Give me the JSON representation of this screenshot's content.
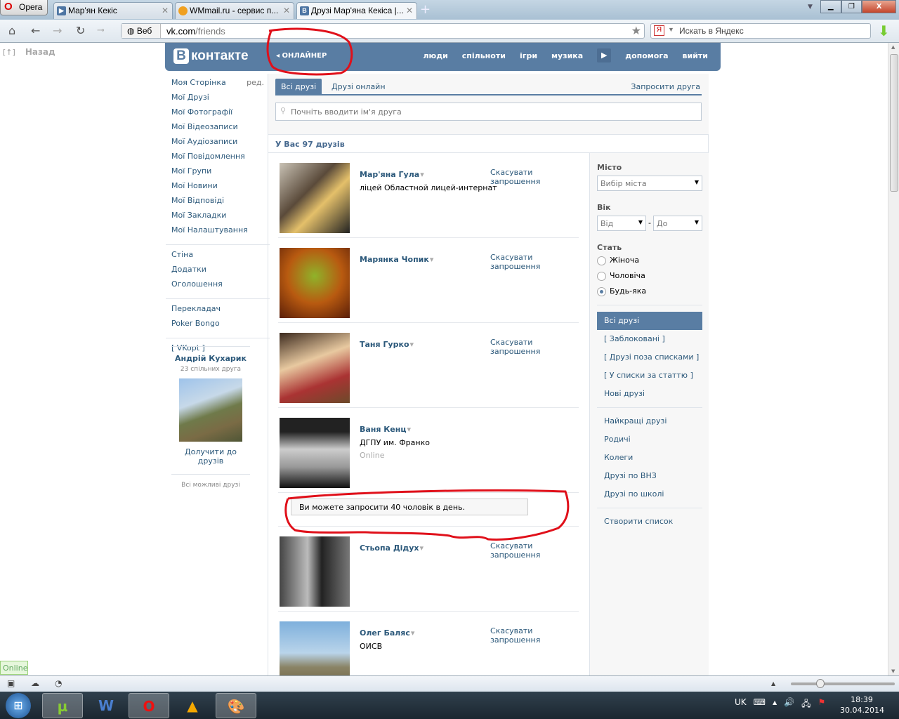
{
  "browser": {
    "menu_label": "Opera",
    "tabs": [
      {
        "title": "Мар'ян Кекіс",
        "icon": "vk-icon"
      },
      {
        "title": "WMmail.ru - сервис п...",
        "icon": "wmmail-icon"
      },
      {
        "title": "Друзі Мар'яна Кекіса |...",
        "icon": "vk-icon",
        "active": true
      }
    ],
    "address_prefix": "Веб",
    "url_host": "vk.com",
    "url_path": "/friends",
    "search_placeholder": "Искать в Яндекс"
  },
  "page": {
    "back_label": "Назад",
    "back_bracket": "[↑]",
    "status_online": "Online"
  },
  "header": {
    "logo": "контакте",
    "logo_letter": "В",
    "onliner": "ОНЛАЙНЕР",
    "nav": [
      "люди",
      "спільноти",
      "ігри",
      "музика",
      "допомога",
      "вийти"
    ]
  },
  "sidebar": {
    "edit_label": "ред.",
    "group1": [
      "Моя Сторінка",
      "Мої Друзі",
      "Мої Фотографії",
      "Мої Відеозаписи",
      "Мої Аудіозаписи",
      "Мої Повідомлення",
      "Мої Групи",
      "Мої Новини",
      "Мої Відповіді",
      "Мої Закладки",
      "Мої Налаштування"
    ],
    "group2": [
      "Стіна",
      "Додатки",
      "Оголошення"
    ],
    "group3": [
      "Перекладач",
      "Poker Bongo"
    ],
    "group4": [
      "[ VKopt ]"
    ],
    "suggestion": {
      "name": "Андрій Кухарик",
      "mutual": "23 спільних друга",
      "add_label": "Долучити до друзів",
      "all_label": "Всі можливі друзі"
    }
  },
  "main": {
    "tabs": [
      "Всі друзі",
      "Друзі онлайн"
    ],
    "invite_label": "Запросити друга",
    "search_placeholder": "Почніть вводити ім'я друга",
    "count_label": "У Вас 97 друзів",
    "cancel_label": "Скасувати запрошення",
    "notice": "Ви можете запросити 40 чоловік в день.",
    "friends": [
      {
        "name": "Мар'яна Гула",
        "info": "ліцей Областной лицей-интернат",
        "status": "",
        "cancel": true
      },
      {
        "name": "Марянка Чопик",
        "info": "",
        "status": "",
        "cancel": true
      },
      {
        "name": "Таня Гурко",
        "info": "",
        "status": "",
        "cancel": true
      },
      {
        "name": "Ваня Кенц",
        "info": "ДГПУ им. Франко",
        "status": "Online",
        "cancel": false
      },
      {
        "name": "Стьопа Дідух",
        "info": "",
        "status": "",
        "cancel": true
      },
      {
        "name": "Олег Баляс",
        "info": "ОИСВ",
        "status": "",
        "cancel": true
      }
    ]
  },
  "filter": {
    "city_label": "Місто",
    "city_value": "Вибір міста",
    "age_label": "Вік",
    "age_from": "Від",
    "age_to": "До",
    "age_sep": "-",
    "sex_label": "Стать",
    "sex_options": [
      "Жіноча",
      "Чоловіча",
      "Будь-яка"
    ],
    "sex_selected": 2,
    "lists1": [
      "Всі друзі",
      "[ Заблоковані ]",
      "[ Друзі поза списками ]",
      "[ У списки за статтю ]",
      "Нові друзі"
    ],
    "lists2": [
      "Найкращі друзі",
      "Родичі",
      "Колеги",
      "Друзі по ВНЗ",
      "Друзі по школі"
    ],
    "create_label": "Створити список"
  },
  "taskbar": {
    "lang": "UK",
    "time": "18:39",
    "date": "30.04.2014"
  },
  "colors": {
    "vk_blue": "#597da3",
    "link": "#2b587a",
    "annotation_red": "#e0101a"
  }
}
